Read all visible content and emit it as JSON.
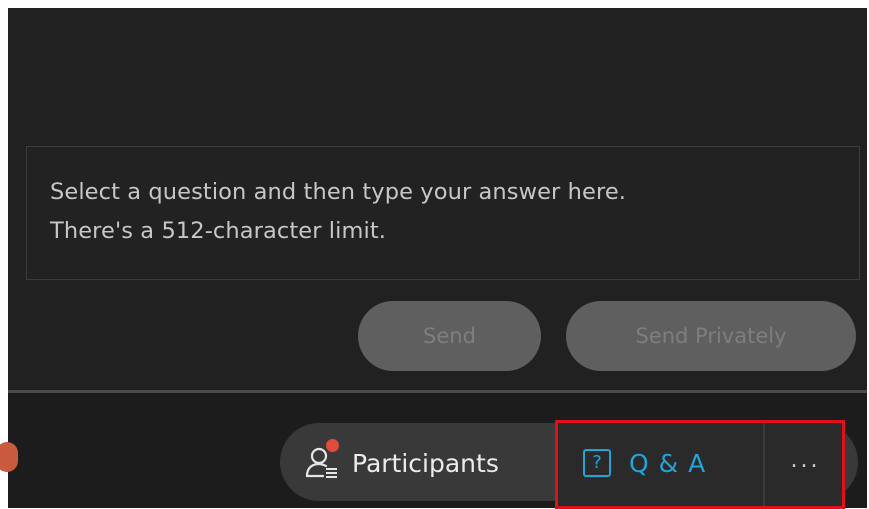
{
  "answer_box": {
    "placeholder": "Select a question and then type your answer here.\nThere's a 512-character limit."
  },
  "actions": {
    "send_label": "Send",
    "send_privately_label": "Send Privately"
  },
  "toolbar": {
    "participants_label": "Participants",
    "participants_icon": "participants-icon",
    "qa_label": "Q & A",
    "qa_icon_glyph": "?",
    "more_label": "...",
    "notification_color": "#e24a3c",
    "accent_color": "#1fa5d8",
    "highlight_color": "#e0101a"
  }
}
